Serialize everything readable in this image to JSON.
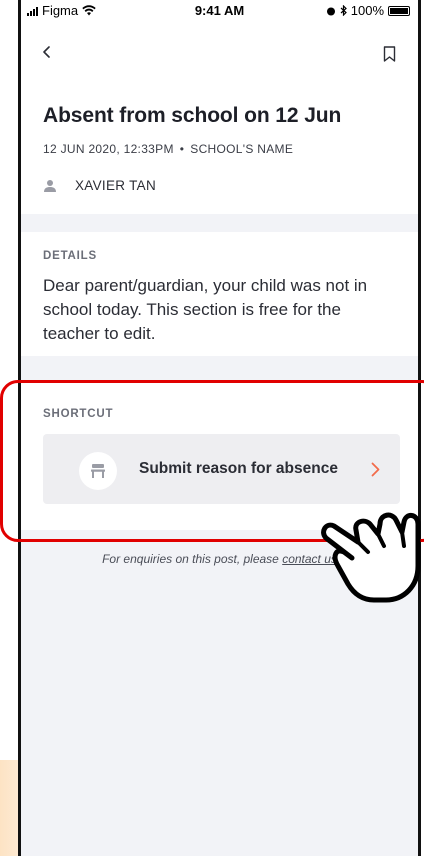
{
  "status_bar": {
    "carrier": "Figma",
    "time": "9:41 AM",
    "battery": "100%"
  },
  "header": {
    "title": "Absent from school on 12 Jun",
    "date": "12 JUN 2020, 12:33PM",
    "separator": "•",
    "school": "SCHOOL'S NAME",
    "student": "XAVIER TAN"
  },
  "details": {
    "label": "DETAILS",
    "body": "Dear parent/guardian, your child was not in school today. This section is free for the teacher to edit."
  },
  "shortcut": {
    "label": "SHORTCUT",
    "button_label": "Submit reason for absence"
  },
  "footer": {
    "enquiry_text": "For enquiries on this post, please ",
    "contact_link": "contact us"
  },
  "colors": {
    "accent_chevron": "#f26b4b",
    "highlight_outline": "#e10000"
  }
}
